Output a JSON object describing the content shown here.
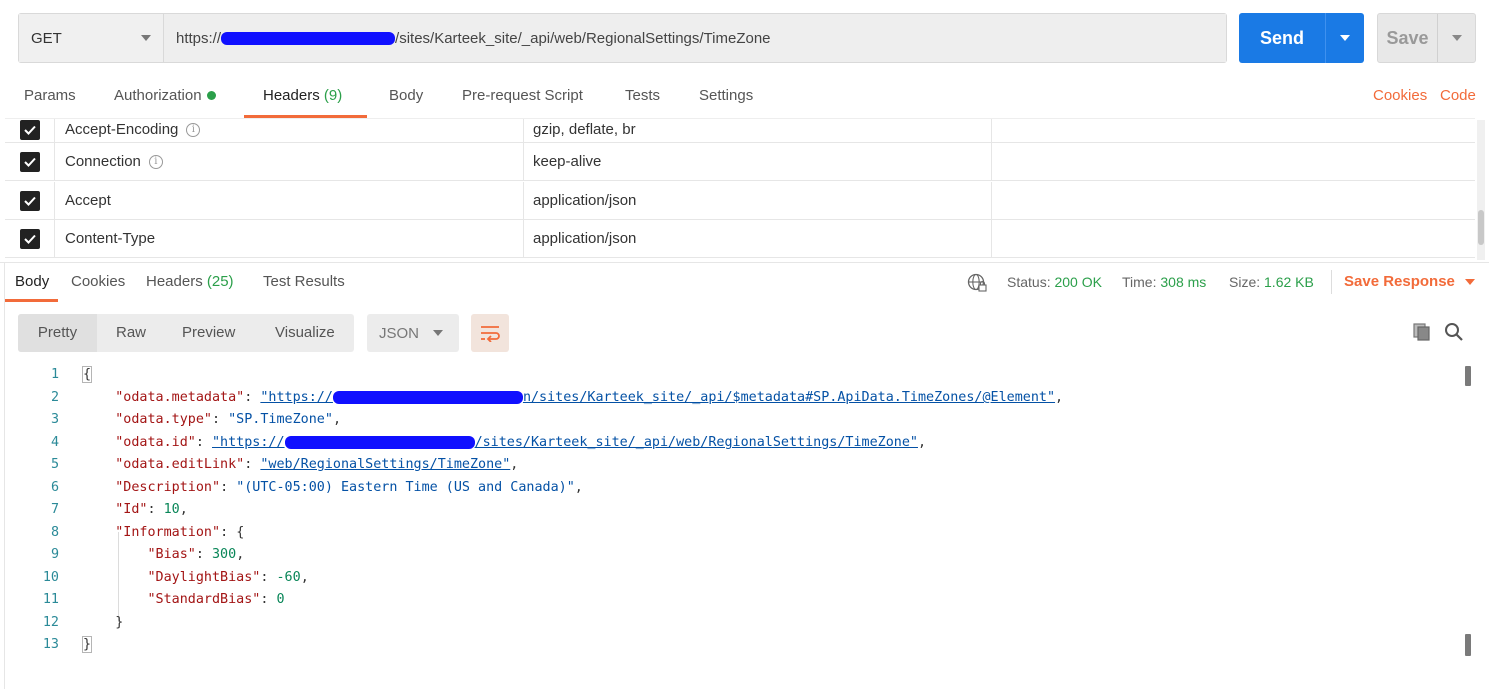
{
  "request": {
    "method": "GET",
    "url_prefix": "https://",
    "url_suffix": "/sites/Karteek_site/_api/web/RegionalSettings/TimeZone",
    "send_label": "Send",
    "save_label": "Save"
  },
  "req_tabs": {
    "params": "Params",
    "authorization": "Authorization",
    "headers": "Headers",
    "headers_count": "(9)",
    "body": "Body",
    "prerequest": "Pre-request Script",
    "tests": "Tests",
    "settings": "Settings",
    "cookies": "Cookies",
    "code": "Code"
  },
  "headers": [
    {
      "key": "Accept-Encoding",
      "value": "gzip, deflate, br",
      "checked": true,
      "info": true
    },
    {
      "key": "Connection",
      "value": "keep-alive",
      "checked": true,
      "info": true
    },
    {
      "key": "Accept",
      "value": "application/json",
      "checked": true,
      "info": false
    },
    {
      "key": "Content-Type",
      "value": "application/json",
      "checked": true,
      "info": false
    }
  ],
  "resp_tabs": {
    "body": "Body",
    "cookies": "Cookies",
    "headers": "Headers",
    "headers_count": "(25)",
    "test_results": "Test Results"
  },
  "status": {
    "status_label": "Status:",
    "status_value": "200 OK",
    "time_label": "Time:",
    "time_value": "308 ms",
    "size_label": "Size:",
    "size_value": "1.62 KB",
    "save_response": "Save Response"
  },
  "view": {
    "pretty": "Pretty",
    "raw": "Raw",
    "preview": "Preview",
    "visualize": "Visualize",
    "format": "JSON"
  },
  "code_lines": {
    "l1_open": "{",
    "l2_key": "\"odata.metadata\"",
    "l2_v1": "\"https://",
    "l2_v2": "n/sites/Karteek_site/_api/$metadata#SP.ApiData.TimeZones/@Element\"",
    "l3_key": "\"odata.type\"",
    "l3_val": "\"SP.TimeZone\"",
    "l4_key": "\"odata.id\"",
    "l4_v1": "\"https://",
    "l4_v2": "/sites/Karteek_site/_api/web/RegionalSettings/TimeZone\"",
    "l5_key": "\"odata.editLink\"",
    "l5_val": "\"web/RegionalSettings/TimeZone\"",
    "l6_key": "\"Description\"",
    "l6_val": "\"(UTC-05:00) Eastern Time (US and Canada)\"",
    "l7_key": "\"Id\"",
    "l7_val": "10",
    "l8_key": "\"Information\"",
    "l8_open": "{",
    "l9_key": "\"Bias\"",
    "l9_val": "300",
    "l10_key": "\"DaylightBias\"",
    "l10_val": "-60",
    "l11_key": "\"StandardBias\"",
    "l11_val": "0",
    "l12_close": "}",
    "l13_close": "}"
  },
  "line_numbers": [
    "1",
    "2",
    "3",
    "4",
    "5",
    "6",
    "7",
    "8",
    "9",
    "10",
    "11",
    "12",
    "13"
  ],
  "colors": {
    "accent": "#f26b3a",
    "send_blue": "#1a7ae5",
    "success_green": "#2b9f4a",
    "redaction": "#1010ff"
  }
}
